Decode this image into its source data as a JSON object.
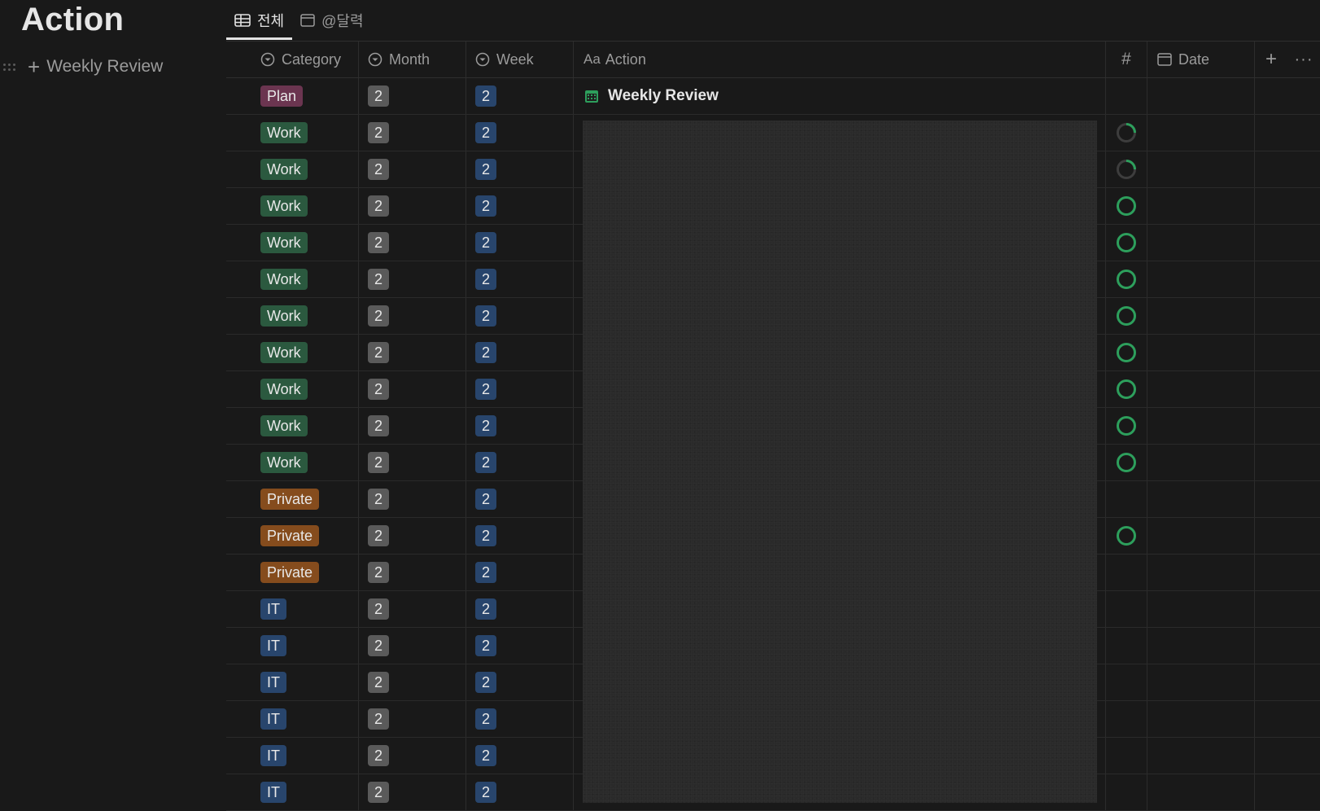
{
  "page": {
    "title": "Action",
    "sidebar_add_label": "Weekly Review"
  },
  "tabs": [
    {
      "label": "전체",
      "icon": "table-icon",
      "active": true
    },
    {
      "label": "@달력",
      "icon": "calendar-icon",
      "active": false
    }
  ],
  "columns": {
    "category": "Category",
    "month": "Month",
    "week": "Week",
    "action_prefix": "Aa",
    "action": "Action",
    "number": "#",
    "date": "Date"
  },
  "colors": {
    "plan": "#6b3550",
    "work": "#2b593f",
    "private": "#854c1d",
    "it": "#28456c",
    "month_badge": "#5a5a5a",
    "week_badge": "#28456c",
    "ring": "#2d9f5c"
  },
  "rows": [
    {
      "category": "Plan",
      "month": "2",
      "week": "2",
      "action": "Weekly Review",
      "status": ""
    },
    {
      "category": "Work",
      "month": "2",
      "week": "2",
      "action": "",
      "status": "loading"
    },
    {
      "category": "Work",
      "month": "2",
      "week": "2",
      "action": "",
      "status": "loading"
    },
    {
      "category": "Work",
      "month": "2",
      "week": "2",
      "action": "",
      "status": "ring"
    },
    {
      "category": "Work",
      "month": "2",
      "week": "2",
      "action": "",
      "status": "ring"
    },
    {
      "category": "Work",
      "month": "2",
      "week": "2",
      "action": "",
      "status": "ring"
    },
    {
      "category": "Work",
      "month": "2",
      "week": "2",
      "action": "",
      "status": "ring"
    },
    {
      "category": "Work",
      "month": "2",
      "week": "2",
      "action": "",
      "status": "ring"
    },
    {
      "category": "Work",
      "month": "2",
      "week": "2",
      "action": "",
      "status": "ring"
    },
    {
      "category": "Work",
      "month": "2",
      "week": "2",
      "action": "",
      "status": "ring"
    },
    {
      "category": "Work",
      "month": "2",
      "week": "2",
      "action": "",
      "status": "ring"
    },
    {
      "category": "Private",
      "month": "2",
      "week": "2",
      "action": "",
      "status": ""
    },
    {
      "category": "Private",
      "month": "2",
      "week": "2",
      "action": "",
      "status": "ring"
    },
    {
      "category": "Private",
      "month": "2",
      "week": "2",
      "action": "",
      "status": ""
    },
    {
      "category": "IT",
      "month": "2",
      "week": "2",
      "action": "",
      "status": ""
    },
    {
      "category": "IT",
      "month": "2",
      "week": "2",
      "action": "",
      "status": ""
    },
    {
      "category": "IT",
      "month": "2",
      "week": "2",
      "action": "",
      "status": ""
    },
    {
      "category": "IT",
      "month": "2",
      "week": "2",
      "action": "",
      "status": ""
    },
    {
      "category": "IT",
      "month": "2",
      "week": "2",
      "action": "",
      "status": ""
    },
    {
      "category": "IT",
      "month": "2",
      "week": "2",
      "action": "",
      "status": ""
    }
  ]
}
